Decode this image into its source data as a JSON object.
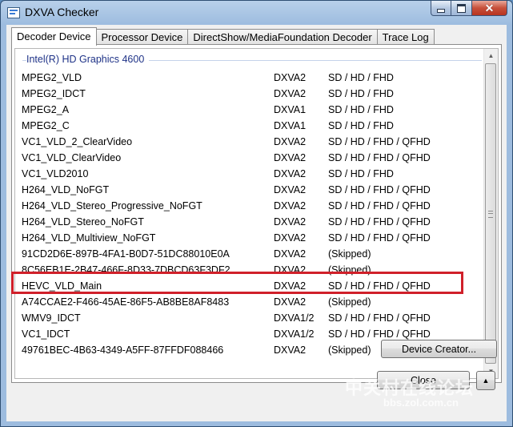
{
  "window": {
    "title": "DXVA Checker",
    "caption_buttons": {
      "minimize": "minimize",
      "maximize": "maximize",
      "close": "✕"
    }
  },
  "tabs": [
    {
      "label": "Decoder Device",
      "active": true
    },
    {
      "label": "Processor Device",
      "active": false
    },
    {
      "label": "DirectShow/MediaFoundation Decoder",
      "active": false
    },
    {
      "label": "Trace Log",
      "active": false
    }
  ],
  "decoder_list": {
    "group": "Intel(R) HD Graphics 4600",
    "rows": [
      {
        "name": "MPEG2_VLD",
        "api": "DXVA2",
        "resolutions": "SD / HD / FHD"
      },
      {
        "name": "MPEG2_IDCT",
        "api": "DXVA2",
        "resolutions": "SD / HD / FHD"
      },
      {
        "name": "MPEG2_A",
        "api": "DXVA1",
        "resolutions": "SD / HD / FHD"
      },
      {
        "name": "MPEG2_C",
        "api": "DXVA1",
        "resolutions": "SD / HD / FHD"
      },
      {
        "name": "VC1_VLD_2_ClearVideo",
        "api": "DXVA2",
        "resolutions": "SD / HD / FHD / QFHD"
      },
      {
        "name": "VC1_VLD_ClearVideo",
        "api": "DXVA2",
        "resolutions": "SD / HD / FHD / QFHD"
      },
      {
        "name": "VC1_VLD2010",
        "api": "DXVA2",
        "resolutions": "SD / HD / FHD"
      },
      {
        "name": "H264_VLD_NoFGT",
        "api": "DXVA2",
        "resolutions": "SD / HD / FHD / QFHD"
      },
      {
        "name": "H264_VLD_Stereo_Progressive_NoFGT",
        "api": "DXVA2",
        "resolutions": "SD / HD / FHD / QFHD"
      },
      {
        "name": "H264_VLD_Stereo_NoFGT",
        "api": "DXVA2",
        "resolutions": "SD / HD / FHD / QFHD"
      },
      {
        "name": "H264_VLD_Multiview_NoFGT",
        "api": "DXVA2",
        "resolutions": "SD / HD / FHD / QFHD"
      },
      {
        "name": "91CD2D6E-897B-4FA1-B0D7-51DC88010E0A",
        "api": "DXVA2",
        "resolutions": "(Skipped)"
      },
      {
        "name": "8C56EB1E-2B47-466F-8D33-7DBCD63F3DF2",
        "api": "DXVA2",
        "resolutions": "(Skipped)"
      },
      {
        "name": "HEVC_VLD_Main",
        "api": "DXVA2",
        "resolutions": "SD / HD / FHD / QFHD"
      },
      {
        "name": "A74CCAE2-F466-45AE-86F5-AB8BE8AF8483",
        "api": "DXVA2",
        "resolutions": "(Skipped)"
      },
      {
        "name": "WMV9_IDCT",
        "api": "DXVA1/2",
        "resolutions": "SD / HD / FHD / QFHD"
      },
      {
        "name": "VC1_IDCT",
        "api": "DXVA1/2",
        "resolutions": "SD / HD / FHD / QFHD"
      },
      {
        "name": "49761BEC-4B63-4349-A5FF-87FFDF088466",
        "api": "DXVA2",
        "resolutions": "(Skipped)"
      }
    ]
  },
  "highlighted_row": "HEVC_VLD_Main",
  "highlight_color": "#d0202a",
  "buttons": {
    "device_creator": "Device Creator...",
    "close": "Close",
    "updown_glyph": "▲"
  },
  "watermark": {
    "line1": "中关村在线论坛",
    "line2": "bbs.zol.com.cn"
  }
}
